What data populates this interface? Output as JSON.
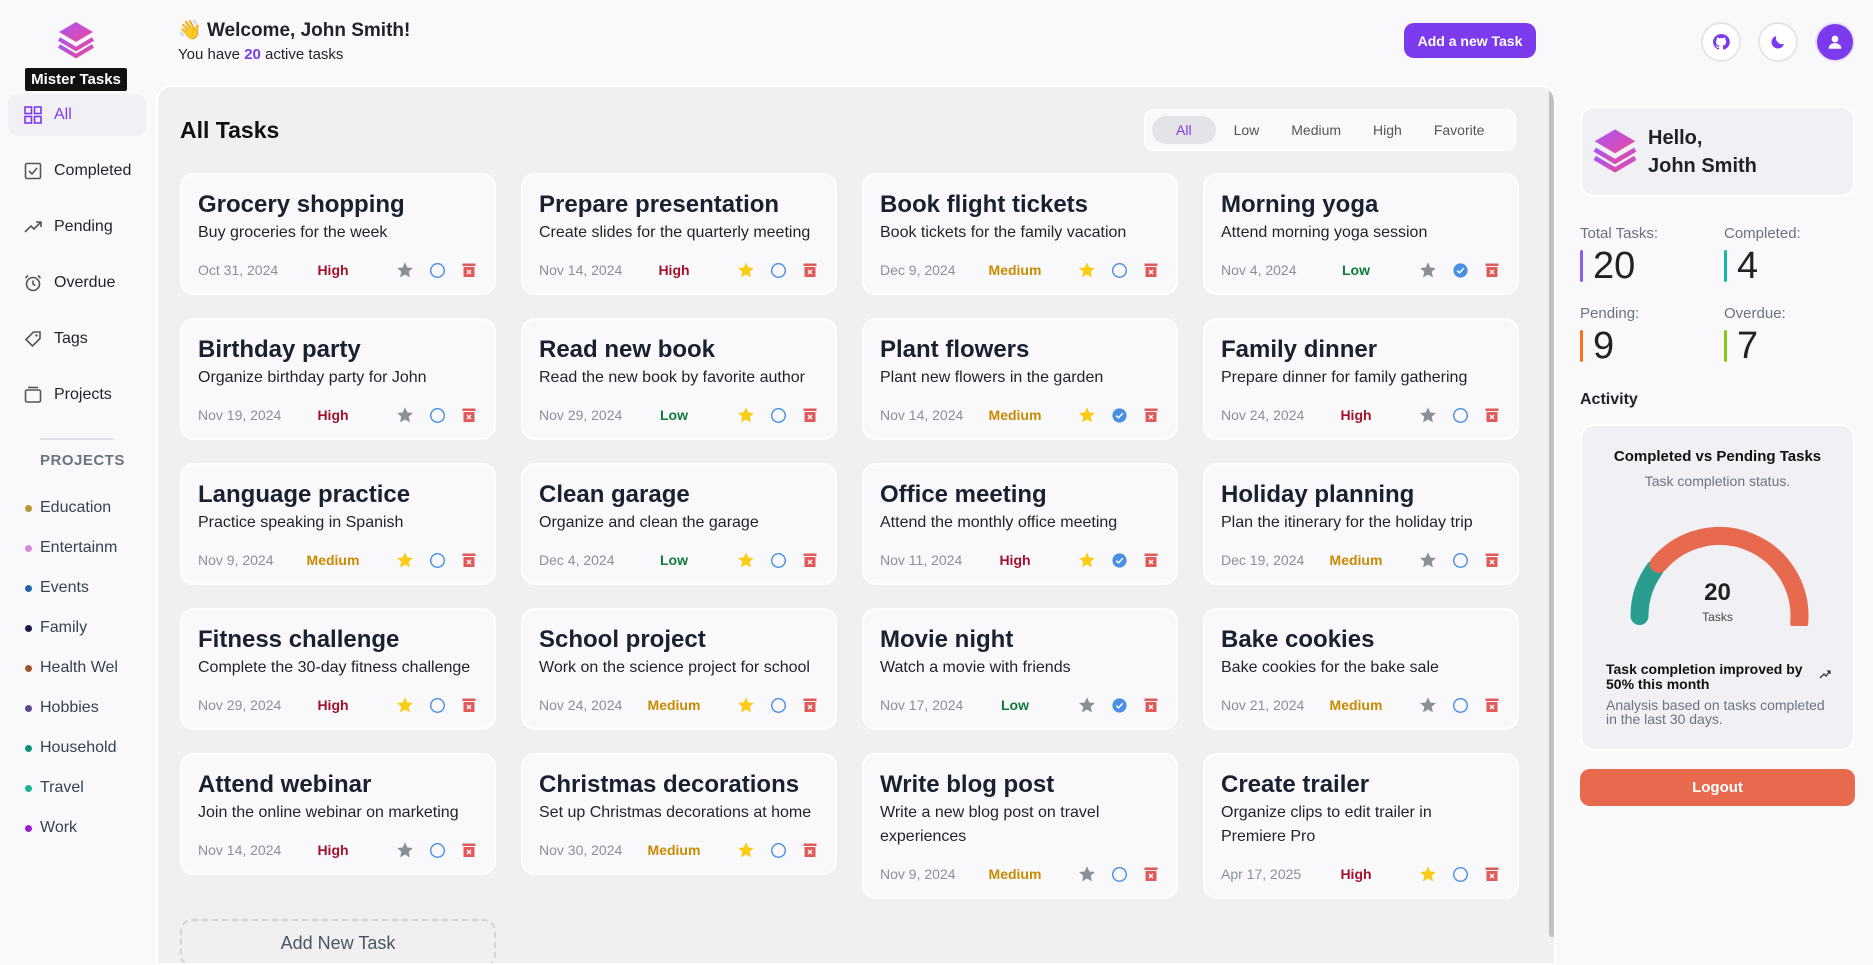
{
  "app": {
    "name": "Mister Tasks"
  },
  "sidebar": {
    "nav": [
      {
        "label": "All",
        "icon": "grid-icon",
        "active": true
      },
      {
        "label": "Completed",
        "icon": "checkbox-icon",
        "active": false
      },
      {
        "label": "Pending",
        "icon": "trend-icon",
        "active": false
      },
      {
        "label": "Overdue",
        "icon": "alarm-icon",
        "active": false
      },
      {
        "label": "Tags",
        "icon": "tag-icon",
        "active": false
      },
      {
        "label": "Projects",
        "icon": "folder-icon",
        "active": false
      }
    ],
    "projects_title": "PROJECTS",
    "projects": [
      {
        "label": "Education",
        "color": "#b59a3a"
      },
      {
        "label": "Entertainm",
        "color": "#d38ad9"
      },
      {
        "label": "Events",
        "color": "#2563a8"
      },
      {
        "label": "Family",
        "color": "#1e1b4b"
      },
      {
        "label": "Health Wel",
        "color": "#a0522d"
      },
      {
        "label": "Hobbies",
        "color": "#5b4b8a"
      },
      {
        "label": "Household",
        "color": "#0f8f7e"
      },
      {
        "label": "Travel",
        "color": "#19b39a"
      },
      {
        "label": "Work",
        "color": "#9b1fcf"
      }
    ]
  },
  "header": {
    "wave": "👋",
    "greeting": "Welcome, John Smith!",
    "sub_prefix": "You have",
    "active_count": "20",
    "sub_suffix": "active tasks",
    "add_button": "Add a new Task"
  },
  "main": {
    "title": "All Tasks",
    "filters": [
      "All",
      "Low",
      "Medium",
      "High",
      "Favorite"
    ],
    "active_filter": "All",
    "add_new_label": "Add New Task",
    "tasks": [
      {
        "title": "Grocery shopping",
        "desc": "Buy groceries for the week",
        "date": "Oct 31, 2024",
        "priority": "High",
        "favorite": false,
        "completed": false
      },
      {
        "title": "Prepare presentation",
        "desc": "Create slides for the quarterly meeting",
        "date": "Nov 14, 2024",
        "priority": "High",
        "favorite": true,
        "completed": false
      },
      {
        "title": "Book flight tickets",
        "desc": "Book tickets for the family vacation",
        "date": "Dec 9, 2024",
        "priority": "Medium",
        "favorite": true,
        "completed": false
      },
      {
        "title": "Morning yoga",
        "desc": "Attend morning yoga session",
        "date": "Nov 4, 2024",
        "priority": "Low",
        "favorite": false,
        "completed": true
      },
      {
        "title": "Birthday party",
        "desc": "Organize birthday party for John",
        "date": "Nov 19, 2024",
        "priority": "High",
        "favorite": false,
        "completed": false
      },
      {
        "title": "Read new book",
        "desc": "Read the new book by favorite author",
        "date": "Nov 29, 2024",
        "priority": "Low",
        "favorite": true,
        "completed": false
      },
      {
        "title": "Plant flowers",
        "desc": "Plant new flowers in the garden",
        "date": "Nov 14, 2024",
        "priority": "Medium",
        "favorite": true,
        "completed": true
      },
      {
        "title": "Family dinner",
        "desc": "Prepare dinner for family gathering",
        "date": "Nov 24, 2024",
        "priority": "High",
        "favorite": false,
        "completed": false
      },
      {
        "title": "Language practice",
        "desc": "Practice speaking in Spanish",
        "date": "Nov 9, 2024",
        "priority": "Medium",
        "favorite": true,
        "completed": false
      },
      {
        "title": "Clean garage",
        "desc": "Organize and clean the garage",
        "date": "Dec 4, 2024",
        "priority": "Low",
        "favorite": true,
        "completed": false
      },
      {
        "title": "Office meeting",
        "desc": "Attend the monthly office meeting",
        "date": "Nov 11, 2024",
        "priority": "High",
        "favorite": true,
        "completed": true
      },
      {
        "title": "Holiday planning",
        "desc": "Plan the itinerary for the holiday trip",
        "date": "Dec 19, 2024",
        "priority": "Medium",
        "favorite": false,
        "completed": false
      },
      {
        "title": "Fitness challenge",
        "desc": "Complete the 30-day fitness challenge",
        "date": "Nov 29, 2024",
        "priority": "High",
        "favorite": true,
        "completed": false
      },
      {
        "title": "School project",
        "desc": "Work on the science project for school",
        "date": "Nov 24, 2024",
        "priority": "Medium",
        "favorite": true,
        "completed": false
      },
      {
        "title": "Movie night",
        "desc": "Watch a movie with friends",
        "date": "Nov 17, 2024",
        "priority": "Low",
        "favorite": false,
        "completed": true
      },
      {
        "title": "Bake cookies",
        "desc": "Bake cookies for the bake sale",
        "date": "Nov 21, 2024",
        "priority": "Medium",
        "favorite": false,
        "completed": false
      },
      {
        "title": "Attend webinar",
        "desc": "Join the online webinar on marketing",
        "date": "Nov 14, 2024",
        "priority": "High",
        "favorite": false,
        "completed": false
      },
      {
        "title": "Christmas decorations",
        "desc": "Set up Christmas decorations at home",
        "date": "Nov 30, 2024",
        "priority": "Medium",
        "favorite": true,
        "completed": false
      },
      {
        "title": "Write blog post",
        "desc": "Write a new blog post on travel experiences",
        "date": "Nov 9, 2024",
        "priority": "Medium",
        "favorite": false,
        "completed": false
      },
      {
        "title": "Create trailer",
        "desc": "Organize clips to edit trailer in Premiere Pro",
        "date": "Apr 17, 2025",
        "priority": "High",
        "favorite": true,
        "completed": false
      }
    ]
  },
  "right": {
    "hello": "Hello,",
    "name": "John Smith",
    "stats": [
      {
        "label": "Total Tasks:",
        "value": "20",
        "color": "#8b5cf6"
      },
      {
        "label": "Completed:",
        "value": "4",
        "color": "#14b8a6"
      },
      {
        "label": "Pending:",
        "value": "9",
        "color": "#f97316"
      },
      {
        "label": "Overdue:",
        "value": "7",
        "color": "#84cc16"
      }
    ],
    "activity_title": "Activity",
    "chart_card": {
      "title": "Completed vs Pending Tasks",
      "subtitle": "Task completion status.",
      "total": "20",
      "total_label": "Tasks",
      "note": "Task completion improved by 50% this month",
      "footer": "Analysis based on tasks completed in the last 30 days."
    },
    "logout": "Logout"
  },
  "chart_data": {
    "type": "pie",
    "title": "Completed vs Pending Tasks",
    "subtitle": "Task completion status.",
    "slices": [
      {
        "value": 4,
        "color": "#2a9d8f"
      },
      {
        "value": 16,
        "color": "#e76a4f"
      }
    ],
    "center_value": 20,
    "center_label": "Tasks"
  },
  "colors": {
    "accent": "#7c3aed",
    "high": "#a1122b",
    "medium": "#c98a00",
    "low": "#107a3b",
    "star_on": "#facc15",
    "star_off": "#8a8f98",
    "check": "#4a90e2",
    "delete": "#e05a5a"
  }
}
